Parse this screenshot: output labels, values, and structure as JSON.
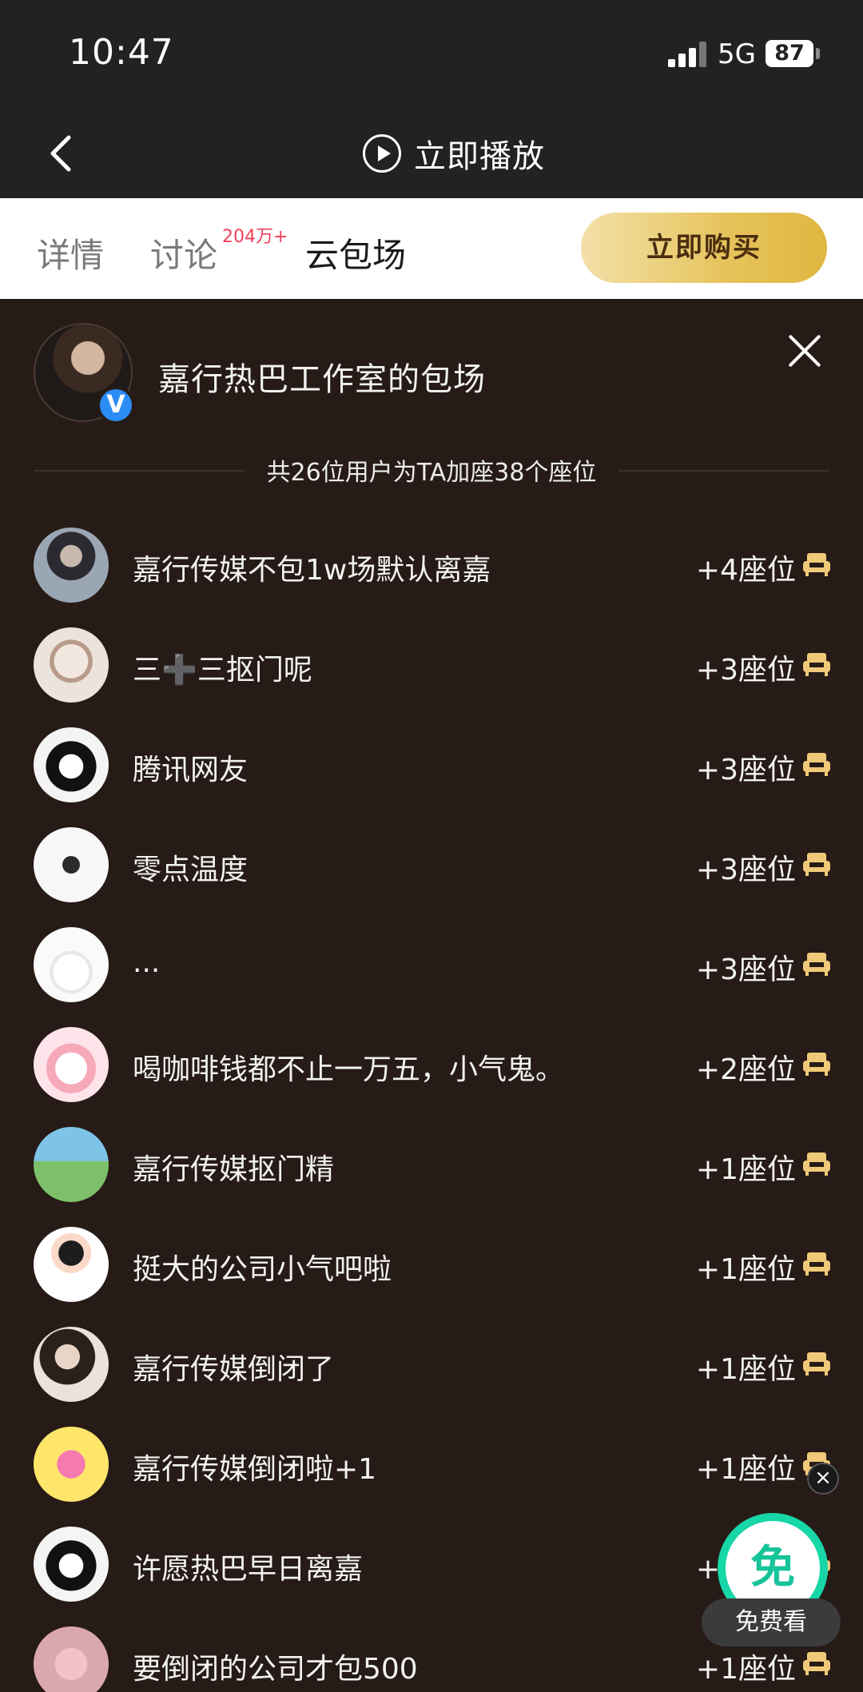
{
  "status_bar": {
    "time": "10:47",
    "network": "5G",
    "battery": "87"
  },
  "nav": {
    "play_label": "立即播放"
  },
  "tabs": [
    {
      "label": "详情"
    },
    {
      "label": "讨论",
      "badge": "204万+"
    },
    {
      "label": "云包场"
    }
  ],
  "buy_button": "立即购买",
  "host": {
    "title": "嘉行热巴工作室的包场",
    "verified_mark": "V"
  },
  "summary": "共26位用户为TA加座38个座位",
  "rows": [
    {
      "name": "嘉行传媒不包1w场默认离嘉",
      "seats": "+4座位"
    },
    {
      "name": "三➕三抠门呢",
      "seats": "+3座位"
    },
    {
      "name": "腾讯网友",
      "seats": "+3座位"
    },
    {
      "name": "零点温度",
      "seats": "+3座位"
    },
    {
      "name": "...",
      "seats": "+3座位"
    },
    {
      "name": "喝咖啡钱都不止一万五，小气鬼。",
      "seats": "+2座位"
    },
    {
      "name": "嘉行传媒抠门精",
      "seats": "+1座位"
    },
    {
      "name": "挺大的公司小气吧啦",
      "seats": "+1座位"
    },
    {
      "name": "嘉行传媒倒闭了",
      "seats": "+1座位"
    },
    {
      "name": "嘉行传媒倒闭啦+1",
      "seats": "+1座位"
    },
    {
      "name": "许愿热巴早日离嘉",
      "seats": "+1座位"
    },
    {
      "name": "要倒闭的公司才包500",
      "seats": "+1座位"
    }
  ],
  "float": {
    "logo": "免",
    "button": "免费看",
    "close": "×"
  },
  "colors": {
    "panel_bg": "#261b16",
    "gold": "#e6c35a",
    "badge_red": "#f0405a",
    "seat_icon": "#f0c978"
  }
}
